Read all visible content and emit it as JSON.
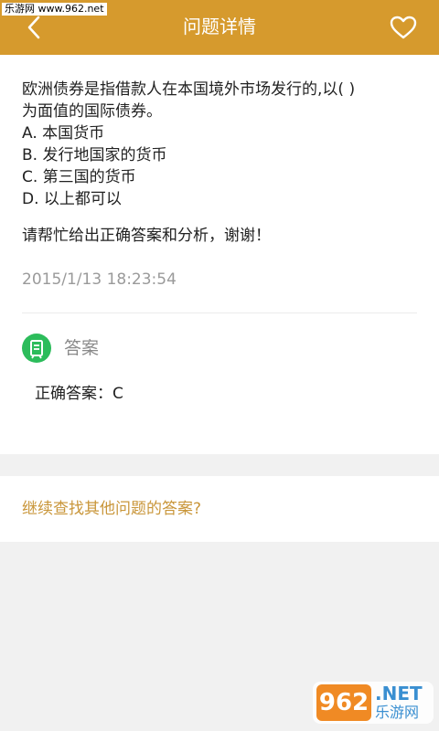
{
  "watermark": {
    "top_left": "乐游网 www.962.net",
    "bottom_right_logo": "962",
    "bottom_right_net": ".NET",
    "bottom_right_cn": "乐游网"
  },
  "header": {
    "title": "问题详情",
    "back_icon": "chevron-left-icon",
    "favorite_icon": "heart-outline-icon",
    "background_color": "#d69a2d"
  },
  "question": {
    "lines": [
      "欧洲债券是指借款人在本国境外市场发行的,以( )",
      "为面值的国际债券。"
    ],
    "options": [
      "A.  本国货币",
      "B.  发行地国家的货币",
      "C.  第三国的货币",
      "D.  以上都可以"
    ],
    "request": "请帮忙给出正确答案和分析，谢谢！",
    "timestamp": "2015/1/13 18:23:54"
  },
  "answer": {
    "section_title": "答案",
    "icon": "answer-badge-icon",
    "icon_color": "#2cbc5b",
    "text": "正确答案：C"
  },
  "footer": {
    "continue_link": "继续查找其他问题的答案?",
    "link_color": "#c9963a"
  }
}
